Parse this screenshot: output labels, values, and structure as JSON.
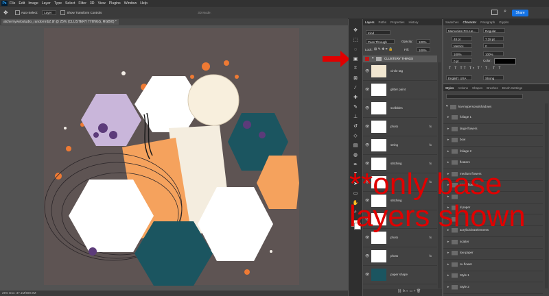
{
  "app": {
    "logo": "Ps",
    "menus": [
      "File",
      "Edit",
      "Image",
      "Layer",
      "Type",
      "Select",
      "Filter",
      "3D",
      "View",
      "Plugins",
      "Window",
      "Help"
    ]
  },
  "options": {
    "auto_select": "Auto-Select:",
    "layer_select": "Layer",
    "show_transform": "Show Transform Controls",
    "mode_3d": "3D Mode:",
    "share": "Share"
  },
  "document": {
    "tab_title": "alchemywebstudio_randomnb2.tif @ 25% (CLUSTERY THINGS, RGB/8) *",
    "status": "25%    Doc: 37.1M/690.9M"
  },
  "layers_panel": {
    "tabs": [
      "Layers",
      "Paths",
      "Properties",
      "History"
    ],
    "kind": "Kind",
    "blend_mode": "Pass Through",
    "opacity_label": "Opacity:",
    "opacity_value": "100%",
    "lock_label": "Lock:",
    "fill_label": "Fill:",
    "fill_value": "100%",
    "group_name": "CLUSTERY THINGS",
    "layers": [
      {
        "name": "circle tag",
        "thumb": "#f1e6d0",
        "fx": false
      },
      {
        "name": "glitter paint",
        "thumb": "#ffffff",
        "fx": false
      },
      {
        "name": "scribbles",
        "thumb": "#ffffff",
        "fx": false
      },
      {
        "name": "photo",
        "thumb": "#ffffff",
        "fx": true
      },
      {
        "name": "string",
        "thumb": "#ffffff",
        "fx": true
      },
      {
        "name": "stitching",
        "thumb": "#ffffff",
        "fx": true
      },
      {
        "name": "",
        "thumb": "#ffffff",
        "fx": true
      },
      {
        "name": "stitching",
        "thumb": "#ffffff",
        "fx": false
      },
      {
        "name": "",
        "thumb": "#ffffff",
        "fx": false
      },
      {
        "name": "photo",
        "thumb": "#ffffff",
        "fx": true
      },
      {
        "name": "photo",
        "thumb": "#ffffff",
        "fx": true
      },
      {
        "name": "paper shape",
        "thumb": "#1b5560",
        "fx": false
      }
    ]
  },
  "character_panel": {
    "tabs": [
      "Swatches",
      "Character",
      "Paragraph",
      "Glyphs"
    ],
    "font_family": "Memoriam Pro He...",
    "font_style": "Regular",
    "size": "48 pt",
    "leading": "7.28 pt",
    "kerning": "Metrics",
    "tracking": "0",
    "v_scale": "100%",
    "h_scale": "100%",
    "baseline": "0 pt",
    "color_label": "Color:",
    "language": "English: USA",
    "anti_alias": "Strong"
  },
  "styles_panel": {
    "tabs": [
      "Styles",
      "Actions",
      "Shapes",
      "Brushes",
      "Brush Settings"
    ],
    "root_folder": "kai-mypersonalshadows",
    "items": [
      "foliage 1",
      "large flowers",
      "bow",
      "foliage 2",
      "floaters",
      "medium flowers",
      "small flowers",
      "",
      "d paper",
      "",
      "acrylic/clearelements",
      "scatter",
      "low paper",
      "cu flower",
      "Style 1",
      "Style 2"
    ]
  },
  "overlay": {
    "line1": "**only base",
    "line2": "layers shown"
  },
  "colors": {
    "accent": "#1473e6",
    "annotation_red": "#e00000",
    "teal": "#1b5560",
    "orange": "#f5a25d",
    "lavender": "#c9b6da",
    "canvas_bg": "#5e5453"
  }
}
